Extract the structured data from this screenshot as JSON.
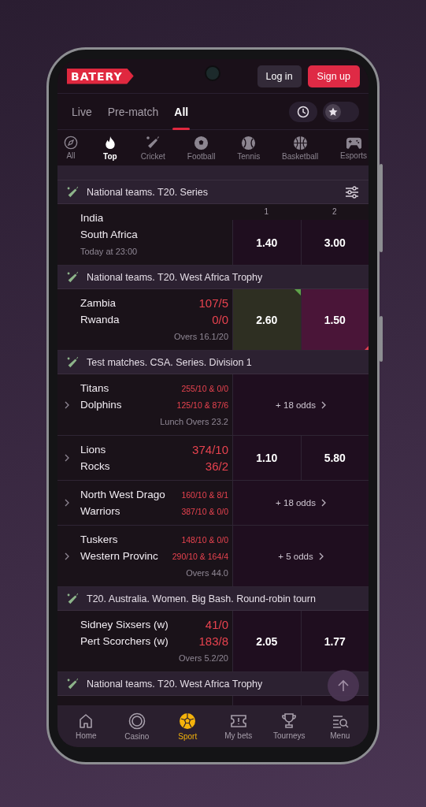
{
  "header": {
    "logo": "BATERY",
    "login": "Log in",
    "signup": "Sign up"
  },
  "tabs": [
    {
      "label": "Live",
      "selected": false
    },
    {
      "label": "Pre-match",
      "selected": false
    },
    {
      "label": "All",
      "selected": true
    }
  ],
  "favorites_toggle": {
    "on": false
  },
  "sports": [
    {
      "label": "All",
      "kind": "compass",
      "selected": false
    },
    {
      "label": "Top",
      "kind": "flame",
      "selected": true
    },
    {
      "label": "Cricket",
      "kind": "cricket",
      "selected": false
    },
    {
      "label": "Football",
      "kind": "football",
      "selected": false
    },
    {
      "label": "Tennis",
      "kind": "tennis",
      "selected": false
    },
    {
      "label": "Basketball",
      "kind": "basketball",
      "selected": false
    },
    {
      "label": "Esports",
      "kind": "gamepad",
      "selected": false
    }
  ],
  "sections": [
    {
      "title": "National teams. T20. Series",
      "has_filter": true,
      "columns": [
        "1",
        "2"
      ],
      "matches": [
        {
          "kind": "odds",
          "expandable": false,
          "teams": [
            {
              "name": "India"
            },
            {
              "name": "South Africa"
            }
          ],
          "info": "Today at 23:00",
          "odds": [
            {
              "value": "1.40",
              "kind": "plain"
            },
            {
              "value": "3.00",
              "kind": "plain"
            }
          ]
        }
      ]
    },
    {
      "title": "National teams. T20. West Africa Trophy",
      "has_filter": false,
      "matches": [
        {
          "kind": "odds",
          "expandable": false,
          "compact_scores": false,
          "teams": [
            {
              "name": "Zambia",
              "score": "107/5"
            },
            {
              "name": "Rwanda",
              "score": "0/0"
            }
          ],
          "info": "Overs 16.1/20",
          "odds": [
            {
              "value": "2.60",
              "kind": "rising"
            },
            {
              "value": "1.50",
              "kind": "falling"
            }
          ]
        }
      ]
    },
    {
      "title": "Test matches. CSA. Series. Division 1",
      "has_filter": false,
      "matches": [
        {
          "kind": "more",
          "expandable": true,
          "compact_scores": true,
          "teams": [
            {
              "name": "Titans",
              "score": "255/10 & 0/0"
            },
            {
              "name": "Dolphins",
              "score": "125/10 & 87/6"
            }
          ],
          "info": "Lunch Overs 23.2",
          "more": "+ 18 odds"
        },
        {
          "kind": "odds",
          "expandable": true,
          "compact_scores": false,
          "teams": [
            {
              "name": "Lions",
              "score": "374/10"
            },
            {
              "name": "Rocks",
              "score": "36/2"
            }
          ],
          "odds": [
            {
              "value": "1.10",
              "kind": "plain"
            },
            {
              "value": "5.80",
              "kind": "plain"
            }
          ]
        },
        {
          "kind": "more",
          "expandable": true,
          "compact_scores": true,
          "teams": [
            {
              "name": "North West Drago",
              "score": "160/10 & 8/1"
            },
            {
              "name": "Warriors",
              "score": "387/10 & 0/0"
            }
          ],
          "more": "+ 18 odds"
        },
        {
          "kind": "more",
          "expandable": true,
          "compact_scores": true,
          "teams": [
            {
              "name": "Tuskers",
              "score": "148/10 & 0/0"
            },
            {
              "name": "Western Provinc",
              "score": "290/10 & 164/4"
            }
          ],
          "info": "Overs 44.0",
          "more": "+ 5 odds"
        }
      ]
    },
    {
      "title": "T20. Australia. Women. Big Bash. Round-robin tourn",
      "has_filter": false,
      "matches": [
        {
          "kind": "odds",
          "expandable": false,
          "compact_scores": false,
          "teams": [
            {
              "name": "Sidney Sixsers (w)",
              "score": "41/0"
            },
            {
              "name": "Pert Scorchers (w)",
              "score": "183/8"
            }
          ],
          "info": "Overs 5.2/20",
          "odds": [
            {
              "value": "2.05",
              "kind": "plain"
            },
            {
              "value": "1.77",
              "kind": "plain"
            }
          ]
        }
      ]
    },
    {
      "title": "National teams. T20. West Africa Trophy"
    }
  ],
  "nav": [
    {
      "label": "Home",
      "kind": "home",
      "selected": false
    },
    {
      "label": "Casino",
      "kind": "chip",
      "selected": false
    },
    {
      "label": "Sport",
      "kind": "ball",
      "selected": true
    },
    {
      "label": "My bets",
      "kind": "ticket",
      "selected": false
    },
    {
      "label": "Tourneys",
      "kind": "trophy",
      "selected": false
    },
    {
      "label": "Menu",
      "kind": "menu",
      "selected": false
    }
  ]
}
